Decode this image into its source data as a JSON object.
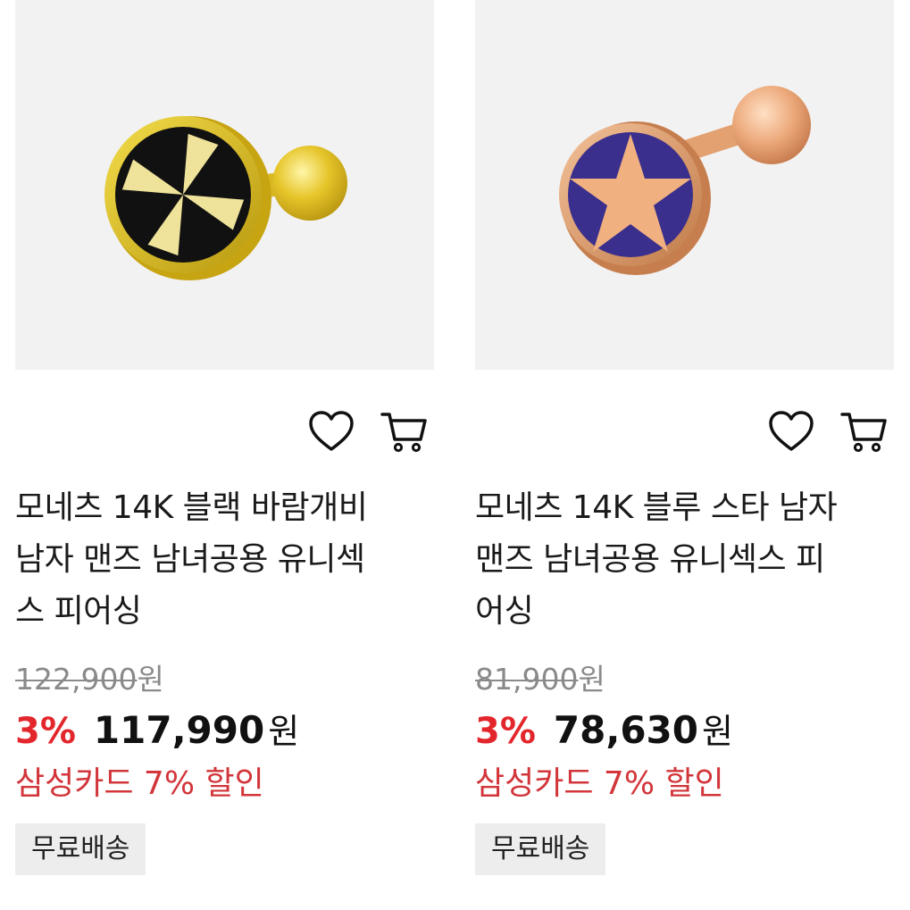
{
  "products": [
    {
      "title_lines": [
        "모네츠 14K 블랙 바람개비",
        "남자 맨즈 남녀공용 유니섹",
        "스 피어싱"
      ],
      "original_price": "122,900",
      "original_unit": "원",
      "discount_rate": "3%",
      "sale_price": "117,990",
      "sale_unit": "원",
      "card_promo": "삼성카드 7% 할인",
      "badge": "무료배송",
      "image_desc": "gold-pinwheel-earring",
      "colors": {
        "metal": "#e8c530",
        "inlay": "#111111"
      }
    },
    {
      "title_lines": [
        "모네츠 14K 블루 스타 남자",
        "맨즈 남녀공용 유니섹스 피",
        "어싱"
      ],
      "original_price": "81,900",
      "original_unit": "원",
      "discount_rate": "3%",
      "sale_price": "78,630",
      "sale_unit": "원",
      "card_promo": "삼성카드 7% 할인",
      "badge": "무료배송",
      "image_desc": "rose-gold-star-earring",
      "colors": {
        "metal": "#e8a874",
        "inlay": "#3a2f8c"
      }
    }
  ],
  "icons": {
    "wishlist": "heart-outline-icon",
    "cart": "cart-add-icon"
  },
  "theme": {
    "accent": "#e3262c",
    "promo": "#d2353a",
    "badge_bg": "#ededed",
    "thumb_bg": "#f2f2f2"
  }
}
